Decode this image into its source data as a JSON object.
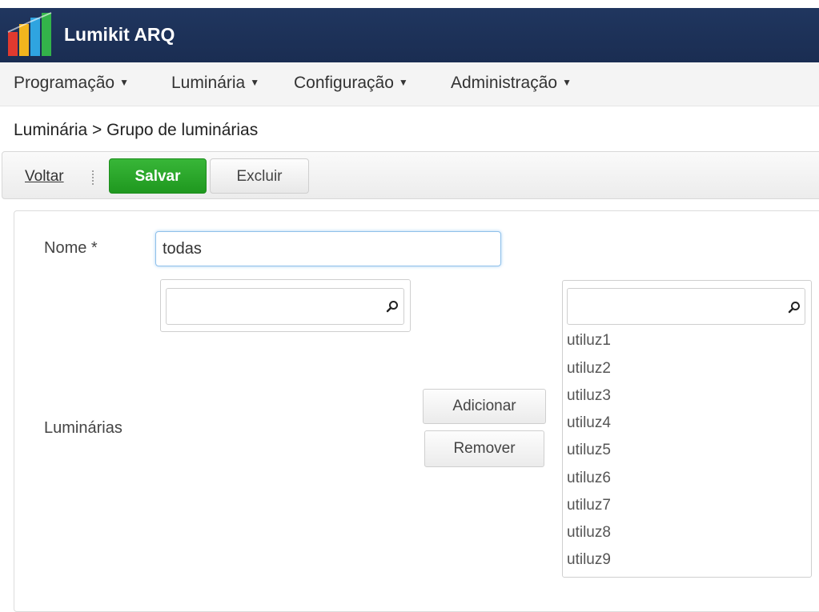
{
  "app": {
    "title": "Lumikit ARQ",
    "logo_icon": "building-logo"
  },
  "menu": {
    "items": [
      {
        "label": "Programação"
      },
      {
        "label": "Luminária"
      },
      {
        "label": "Configuração"
      },
      {
        "label": "Administração"
      }
    ]
  },
  "breadcrumb": {
    "text": "Luminária > Grupo de luminárias"
  },
  "toolbar": {
    "back_label": "Voltar",
    "save_label": "Salvar",
    "delete_label": "Excluir",
    "save_color": "#28a428"
  },
  "form": {
    "name_label": "Nome *",
    "name_value": "todas",
    "luminarias_label": "Luminárias",
    "add_label": "Adicionar",
    "remove_label": "Remover",
    "available": {
      "filter_value": "",
      "items": []
    },
    "selected": {
      "filter_value": "",
      "items": [
        "utiluz1",
        "utiluz2",
        "utiluz3",
        "utiluz4",
        "utiluz5",
        "utiluz6",
        "utiluz7",
        "utiluz8",
        "utiluz9"
      ]
    }
  }
}
